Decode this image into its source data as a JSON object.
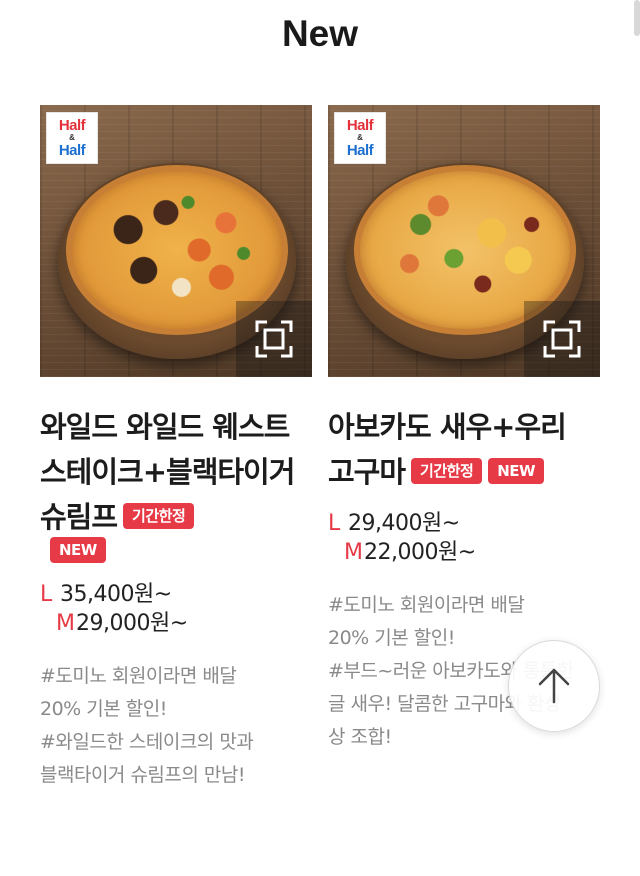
{
  "section": {
    "title": "New"
  },
  "badge": {
    "line1": "Half",
    "amp": "&",
    "line2": "Half"
  },
  "products": [
    {
      "name": "와일드 와일드 웨스트 스테이크+블랙타이거 슈림프",
      "tags": [
        "기간한정",
        "NEW"
      ],
      "price_l_label": "L",
      "price_l": "35,400원~",
      "price_m_label": "M",
      "price_m": "29,000원~",
      "desc_lines": [
        "#도미노 회원이라면 배달",
        "20% 기본 할인!",
        "#와일드한 스테이크의 맛과",
        "블랙타이거 슈림프의 만남!"
      ]
    },
    {
      "name": "아보카도 새우+우리 고구마",
      "tags": [
        "기간한정",
        "NEW"
      ],
      "price_l_label": "L",
      "price_l": "29,400원~",
      "price_m_label": "M",
      "price_m": "22,000원~",
      "desc_lines": [
        "#도미노 회원이라면 배달",
        "20% 기본 할인!",
        "#부드~러운 아보카도와 통통한",
        "글 새우! 달콤한 고구마와 환상",
        "상 조합!"
      ]
    }
  ],
  "icons": {
    "zoom": "expand-frame-icon",
    "scroll_top": "arrow-up-icon"
  },
  "colors": {
    "accent": "#e63a46",
    "half_red": "#e3323b",
    "half_blue": "#1d6fd1",
    "desc_gray": "#8a8a8a"
  }
}
